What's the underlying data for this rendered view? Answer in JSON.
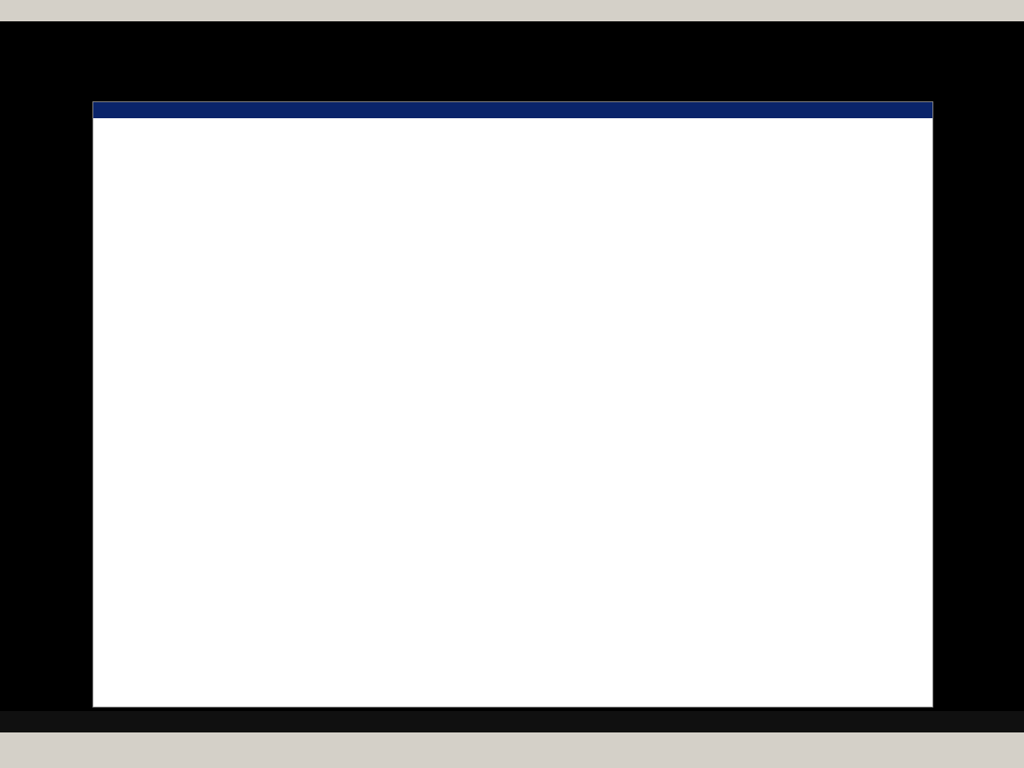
{
  "menu": [],
  "dialog": {
    "title": ""
  },
  "status": {
    "text": ""
  }
}
